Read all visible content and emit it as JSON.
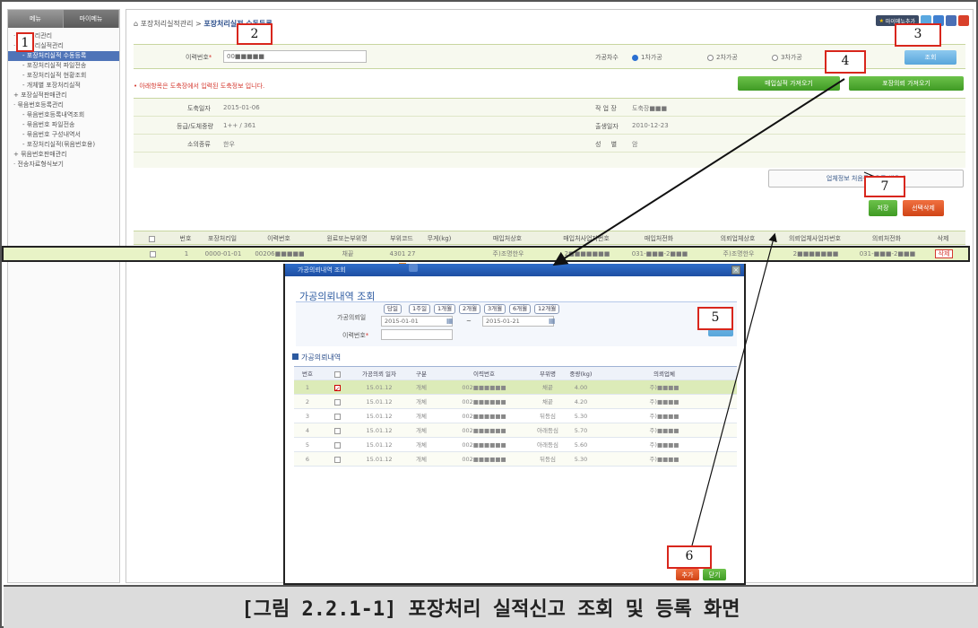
{
  "sidebar": {
    "tabs": [
      "메뉴",
      "마이메뉴"
    ],
    "items": [
      {
        "label": "· 포장처리관리",
        "level": 1
      },
      {
        "label": "· 포장처리실적관리",
        "level": 1
      },
      {
        "label": "- 포장처리실적 수동등록",
        "level": 2,
        "selected": true
      },
      {
        "label": "- 포장처리실적 파일전송",
        "level": 2
      },
      {
        "label": "- 포장처리실적 현황조회",
        "level": 2
      },
      {
        "label": "- 개체별 포장처리실적",
        "level": 2
      },
      {
        "label": "+ 포장실적판매관리",
        "level": 1
      },
      {
        "label": "· 묶음번호등록관리",
        "level": 1
      },
      {
        "label": "- 묶음번호등록내역조회",
        "level": 2
      },
      {
        "label": "- 묶음번호 파일전송",
        "level": 2
      },
      {
        "label": "- 묶음번호 구성내역서",
        "level": 2
      },
      {
        "label": "- 포장처리실적(묶음번호용)",
        "level": 2
      },
      {
        "label": "+ 묶음번호판매관리",
        "level": 1
      },
      {
        "label": "· 전송자료형식보기",
        "level": 1
      }
    ]
  },
  "header": {
    "breadcrumb_prefix": "포장처리실적관리 >",
    "breadcrumb_current": "포장처리실적 수동등록",
    "my_menu_add": "마이메뉴추가"
  },
  "search": {
    "trace_label": "이력번호",
    "trace_value": "00■■■■■",
    "process_label": "가공차수",
    "options": [
      "1차가공",
      "2차가공",
      "3차가공"
    ],
    "selected_option": 0,
    "search_button": "조회"
  },
  "notice": "• 아래항목은 도축장에서 입력된 도축정보 입니다.",
  "buttons": {
    "purchase_import": "매입실적 가져오기",
    "request_import": "포장의뢰 가져오기",
    "business_fill": "업체정보 처음등록으로 채우기",
    "save": "저장",
    "delete_selected": "선택삭제"
  },
  "info": {
    "slaughter_date_label": "도축일자",
    "slaughter_date": "2015-01-06",
    "workplace_label": "작 업 장",
    "workplace": "도축장■■■",
    "grade_label": "등급/도체중량",
    "grade": "1++ / 361",
    "birth_label": "출생일자",
    "birth": "2010-12-23",
    "breed_label": "소의종류",
    "breed": "한우",
    "sex_label": "성     별",
    "sex": "암"
  },
  "table": {
    "columns": [
      "",
      "번호",
      "포장처리일",
      "이력번호",
      "원료또는부위명",
      "부위코드",
      "무게(kg)",
      "매입처상호",
      "매입처사업자번호",
      "매입처전화",
      "의뢰업체상호",
      "의뢰업체사업자번호",
      "의뢰처전화",
      "삭제"
    ],
    "row": [
      "",
      "1",
      "0000-01-01",
      "00206■■■■■",
      "채끝",
      "4301 27",
      "",
      "주)조명한우",
      "2■■■■■■■",
      "031-■■■-2■■■",
      "주)조명한우",
      "2■■■■■■■",
      "031-■■■-2■■■",
      "삭제"
    ]
  },
  "popup": {
    "window_title": "가공의뢰내역 조회",
    "title": "가공의뢰내역 조회",
    "date_label": "가공의뢰일",
    "periods": [
      "당일",
      "1주일",
      "1개월",
      "2개월",
      "3개월",
      "6개월",
      "12개월"
    ],
    "date_from": "2015-01-01",
    "date_sep": "~",
    "date_to": "2015-01-21",
    "trace_label": "이력번호",
    "search_button": "조회",
    "section_title": "가공의뢰내역",
    "columns": [
      "번호",
      "",
      "가공의뢰 일자",
      "구분",
      "이력번호",
      "부위명",
      "중량(kg)",
      "의뢰업체"
    ],
    "rows": [
      [
        "1",
        "checked",
        "15.01.12",
        "개체",
        "002■■■■■■",
        "채끝",
        "4.00",
        "주)■■■■"
      ],
      [
        "2",
        "",
        "15.01.12",
        "개체",
        "002■■■■■■",
        "채끝",
        "4.20",
        "주)■■■■"
      ],
      [
        "3",
        "",
        "15.01.12",
        "개체",
        "002■■■■■■",
        "뒤등심",
        "5.30",
        "주)■■■■"
      ],
      [
        "4",
        "",
        "15.01.12",
        "개체",
        "002■■■■■■",
        "아래등심",
        "5.70",
        "주)■■■■"
      ],
      [
        "5",
        "",
        "15.01.12",
        "개체",
        "002■■■■■■",
        "아래등심",
        "5.60",
        "주)■■■■"
      ],
      [
        "6",
        "",
        "15.01.12",
        "개체",
        "002■■■■■■",
        "뒤등심",
        "5.30",
        "주)■■■■"
      ]
    ],
    "add_button": "추가",
    "close_button": "닫기"
  },
  "annotations": [
    "1",
    "2",
    "3",
    "4",
    "5",
    "6",
    "7"
  ],
  "caption": "[그림 2.2.1-1] 포장처리 실적신고 조회 및 등록 화면",
  "colors": {
    "accent_blue": "#2c5aa0",
    "highlight_red": "#d8261c",
    "green_button": "#3f9a24",
    "orange_button": "#d04416"
  }
}
